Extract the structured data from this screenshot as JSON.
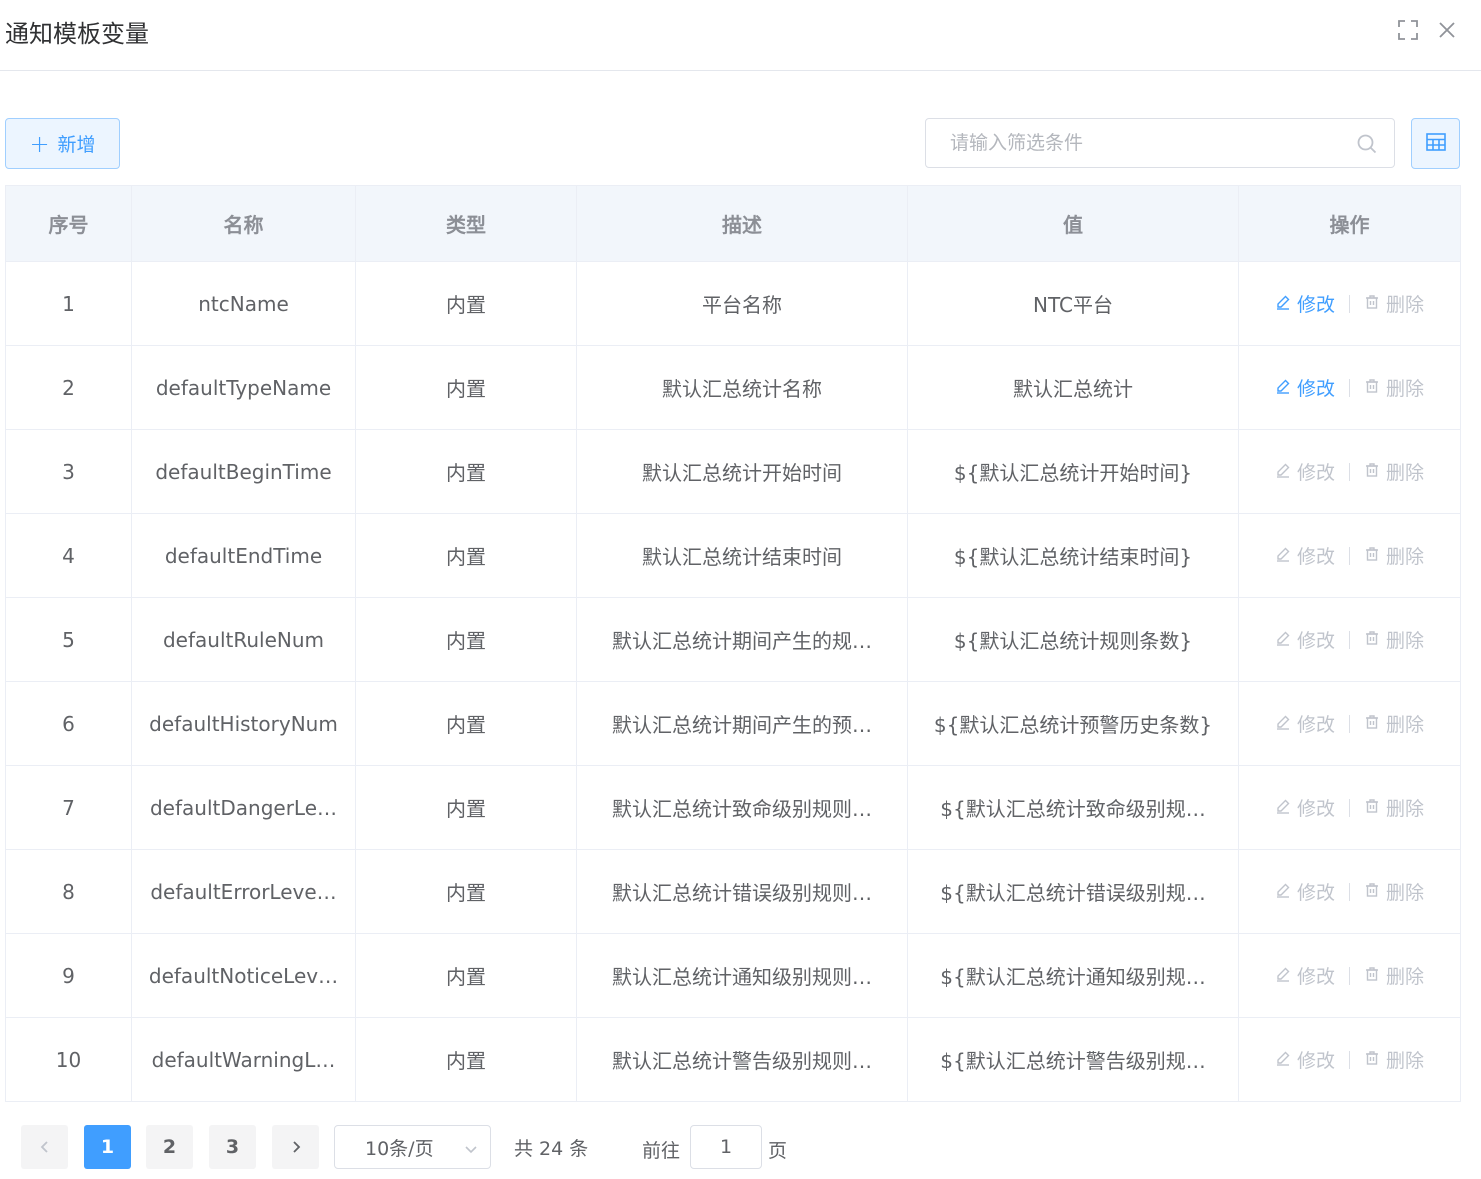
{
  "dialog": {
    "title": "通知模板变量"
  },
  "toolbar": {
    "add_label": "新增",
    "search_placeholder": "请输入筛选条件"
  },
  "table": {
    "columns": [
      "序号",
      "名称",
      "类型",
      "描述",
      "值",
      "操作"
    ],
    "rows": [
      {
        "index": "1",
        "name": "ntcName",
        "type": "内置",
        "desc": "平台名称",
        "value": "NTC平台",
        "editable": true
      },
      {
        "index": "2",
        "name": "defaultTypeName",
        "type": "内置",
        "desc": "默认汇总统计名称",
        "value": "默认汇总统计",
        "editable": true
      },
      {
        "index": "3",
        "name": "defaultBeginTime",
        "type": "内置",
        "desc": "默认汇总统计开始时间",
        "value": "${默认汇总统计开始时间}",
        "editable": false
      },
      {
        "index": "4",
        "name": "defaultEndTime",
        "type": "内置",
        "desc": "默认汇总统计结束时间",
        "value": "${默认汇总统计结束时间}",
        "editable": false
      },
      {
        "index": "5",
        "name": "defaultRuleNum",
        "type": "内置",
        "desc": "默认汇总统计期间产生的规…",
        "value": "${默认汇总统计规则条数}",
        "editable": false
      },
      {
        "index": "6",
        "name": "defaultHistoryNum",
        "type": "内置",
        "desc": "默认汇总统计期间产生的预…",
        "value": "${默认汇总统计预警历史条数}",
        "editable": false
      },
      {
        "index": "7",
        "name": "defaultDangerLe…",
        "type": "内置",
        "desc": "默认汇总统计致命级别规则…",
        "value": "${默认汇总统计致命级别规…",
        "editable": false
      },
      {
        "index": "8",
        "name": "defaultErrorLeve…",
        "type": "内置",
        "desc": "默认汇总统计错误级别规则…",
        "value": "${默认汇总统计错误级别规…",
        "editable": false
      },
      {
        "index": "9",
        "name": "defaultNoticeLev…",
        "type": "内置",
        "desc": "默认汇总统计通知级别规则…",
        "value": "${默认汇总统计通知级别规…",
        "editable": false
      },
      {
        "index": "10",
        "name": "defaultWarningL…",
        "type": "内置",
        "desc": "默认汇总统计警告级别规则…",
        "value": "${默认汇总统计警告级别规…",
        "editable": false
      }
    ],
    "edit_label": "修改",
    "delete_label": "删除"
  },
  "pagination": {
    "pages": [
      "1",
      "2",
      "3"
    ],
    "current_page": "1",
    "page_size": "10条/页",
    "total_text": "共 24 条",
    "goto_label": "前往",
    "goto_value": "1",
    "goto_suffix": "页"
  },
  "colors": {
    "primary": "#409eff",
    "disabled": "#c0c4cc",
    "header_bg": "#f2f6fb",
    "border": "#ebeef5"
  },
  "icons": {
    "fullscreen": "fullscreen-icon",
    "close": "close-icon",
    "search": "search-icon",
    "columns": "table-columns-icon",
    "edit": "edit-icon",
    "delete": "delete-icon",
    "prev": "chevron-left-icon",
    "next": "chevron-right-icon",
    "caret": "chevron-down-icon"
  }
}
